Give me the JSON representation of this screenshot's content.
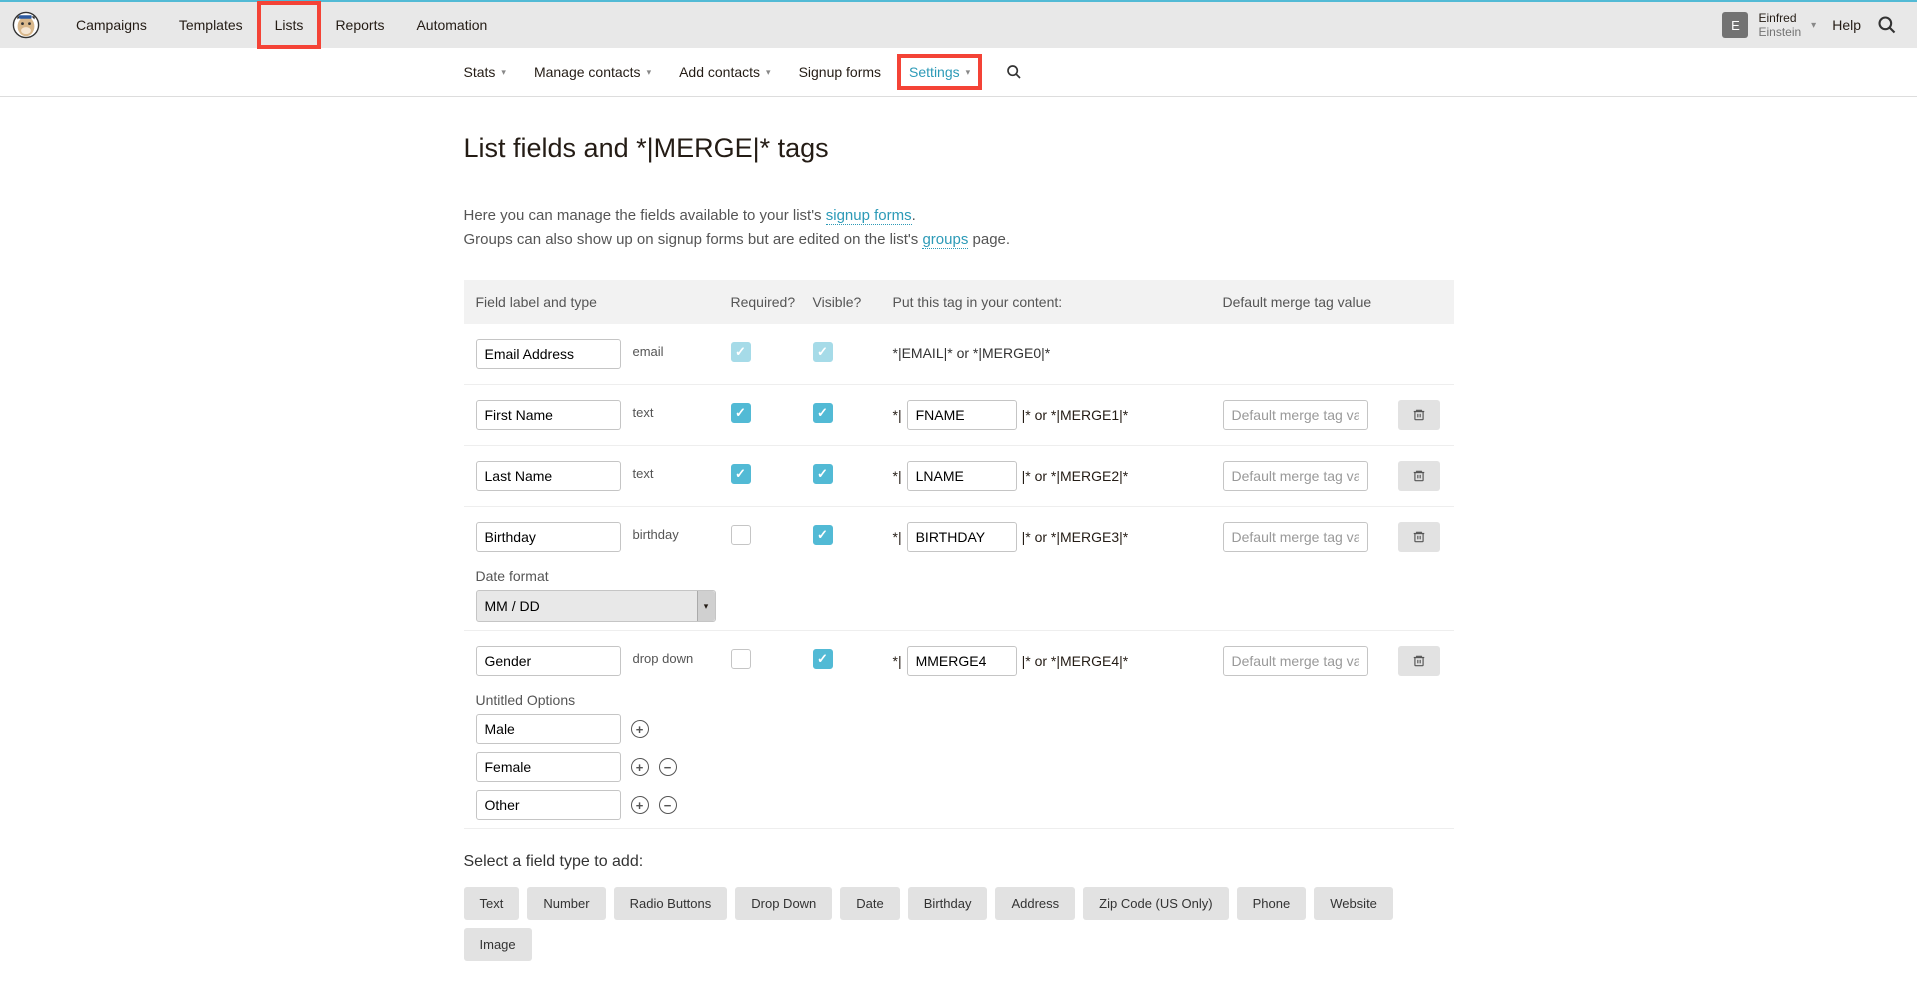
{
  "topNav": {
    "items": [
      "Campaigns",
      "Templates",
      "Lists",
      "Reports",
      "Automation"
    ],
    "highlightIndex": 2
  },
  "user": {
    "initial": "E",
    "name": "Einfred",
    "sub": "Einstein",
    "help": "Help"
  },
  "subNav": {
    "items": [
      {
        "label": "Stats",
        "chev": true
      },
      {
        "label": "Manage contacts",
        "chev": true
      },
      {
        "label": "Add contacts",
        "chev": true
      },
      {
        "label": "Signup forms",
        "chev": false
      },
      {
        "label": "Settings",
        "chev": true,
        "active": true,
        "highlight": true
      }
    ]
  },
  "page": {
    "title": "List fields and *|MERGE|* tags",
    "intro1a": "Here you can manage the fields available to your list's ",
    "intro1link": "signup forms",
    "intro1b": ".",
    "intro2a": "Groups can also show up on signup forms but are edited on the list's ",
    "intro2link": "groups",
    "intro2b": " page."
  },
  "columns": {
    "label": "Field label and type",
    "required": "Required?",
    "visible": "Visible?",
    "tag": "Put this tag in your content:",
    "default": "Default merge tag value"
  },
  "defaultPlaceholder": "Default merge tag value",
  "fields": [
    {
      "label": "Email Address",
      "type": "email",
      "required": true,
      "requiredLocked": true,
      "visible": true,
      "visibleLocked": true,
      "tagStatic": "*|EMAIL|* or *|MERGE0|*",
      "hasDefault": false,
      "deletable": false
    },
    {
      "label": "First Name",
      "type": "text",
      "required": true,
      "visible": true,
      "tagPrefix": "*|",
      "tagValue": "FNAME",
      "tagSuffix": "|* or *|MERGE1|*",
      "hasDefault": true,
      "deletable": true
    },
    {
      "label": "Last Name",
      "type": "text",
      "required": true,
      "visible": true,
      "tagPrefix": "*|",
      "tagValue": "LNAME",
      "tagSuffix": "|* or *|MERGE2|*",
      "hasDefault": true,
      "deletable": true
    },
    {
      "label": "Birthday",
      "type": "birthday",
      "required": false,
      "visible": true,
      "tagPrefix": "*|",
      "tagValue": "BIRTHDAY",
      "tagSuffix": "|* or *|MERGE3|*",
      "hasDefault": true,
      "deletable": true,
      "extra": {
        "kind": "dateformat",
        "label": "Date format",
        "value": "MM / DD"
      }
    },
    {
      "label": "Gender",
      "type": "drop down",
      "required": false,
      "visible": true,
      "tagPrefix": "*|",
      "tagValue": "MMERGE4",
      "tagSuffix": "|* or *|MERGE4|*",
      "hasDefault": true,
      "deletable": true,
      "extra": {
        "kind": "options",
        "label": "Untitled Options",
        "options": [
          "Male",
          "Female",
          "Other"
        ]
      }
    }
  ],
  "addSection": {
    "title": "Select a field type to add:",
    "buttons": [
      "Text",
      "Number",
      "Radio Buttons",
      "Drop Down",
      "Date",
      "Birthday",
      "Address",
      "Zip Code (US Only)",
      "Phone",
      "Website",
      "Image"
    ]
  }
}
